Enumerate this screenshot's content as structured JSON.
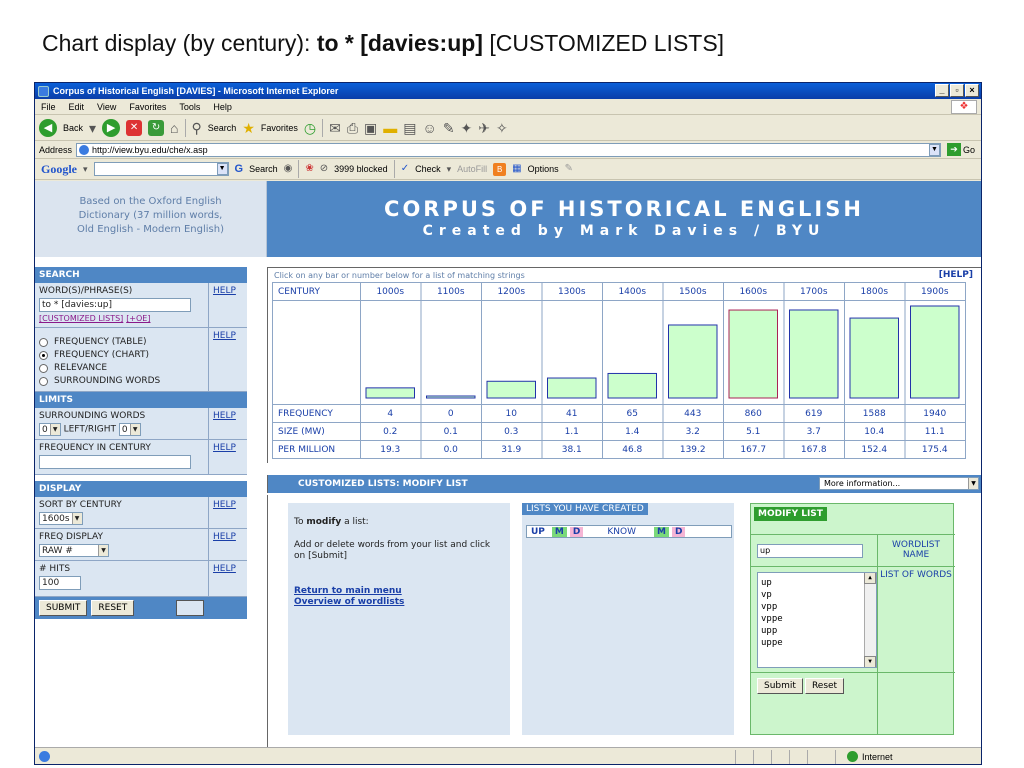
{
  "slide": {
    "prefix": "Chart display (by century): ",
    "query": "to * [davies:up]",
    "suffix": " [CUSTOMIZED LISTS]"
  },
  "browser": {
    "title": "Corpus of Historical English [DAVIES] - Microsoft Internet Explorer",
    "menu": [
      "File",
      "Edit",
      "View",
      "Favorites",
      "Tools",
      "Help"
    ],
    "toolbar": {
      "back": "Back",
      "search": "Search",
      "favorites": "Favorites"
    },
    "address_label": "Address",
    "address_url": "http://view.byu.edu/che/x.asp",
    "go_label": "Go",
    "google": {
      "logo": "Google",
      "search": "Search",
      "blocked": "3999 blocked",
      "check": "Check",
      "autofill": "AutoFill",
      "options": "Options"
    },
    "status_zone": "Internet"
  },
  "header": {
    "left_text": [
      "Based on the Oxford English",
      "Dictionary (37 million words,",
      "Old English - Modern English)"
    ],
    "site_title": "CORPUS OF HISTORICAL ENGLISH",
    "site_subtitle": "Created by Mark Davies / BYU"
  },
  "sidebar": {
    "search_head": "SEARCH",
    "word_label": "WORD(S)/PHRASE(S)",
    "help": "HELP",
    "word_value": "to * [davies:up]",
    "customized_link": "[CUSTOMIZED LISTS]",
    "oe_link": "[+OE]",
    "radios": [
      {
        "label": "FREQUENCY (TABLE)",
        "checked": false
      },
      {
        "label": "FREQUENCY (CHART)",
        "checked": true
      },
      {
        "label": "RELEVANCE",
        "checked": false
      },
      {
        "label": "SURROUNDING WORDS",
        "checked": false
      }
    ],
    "limits_head": "LIMITS",
    "surrounding_label": "SURROUNDING WORDS",
    "left_value": "0",
    "leftright_label": "LEFT/RIGHT",
    "right_value": "0",
    "freq_century_label": "FREQUENCY IN CENTURY",
    "display_head": "DISPLAY",
    "sort_label": "SORT BY CENTURY",
    "sort_value": "1600s",
    "freq_display_label": "FREQ DISPLAY",
    "freq_display_value": "RAW #",
    "hits_label": "# HITS",
    "hits_value": "100",
    "submit": "SUBMIT",
    "reset": "RESET"
  },
  "chart_caption": "Click on any bar or number below for a list of matching strings",
  "chart_help": "[HELP]",
  "chart_data": {
    "type": "bar",
    "header_label": "CENTURY",
    "categories": [
      "1000s",
      "1100s",
      "1200s",
      "1300s",
      "1400s",
      "1500s",
      "1600s",
      "1700s",
      "1800s",
      "1900s"
    ],
    "bar_values": [
      19.3,
      0.0,
      31.9,
      38.1,
      46.8,
      139.2,
      167.7,
      167.8,
      152.4,
      175.4
    ],
    "highlight_index": 6,
    "rows": [
      {
        "label": "FREQUENCY",
        "values": [
          "4",
          "0",
          "10",
          "41",
          "65",
          "443",
          "860",
          "619",
          "1588",
          "1940"
        ]
      },
      {
        "label": "SIZE (MW)",
        "values": [
          "0.2",
          "0.1",
          "0.3",
          "1.1",
          "1.4",
          "3.2",
          "5.1",
          "3.7",
          "10.4",
          "11.1"
        ]
      },
      {
        "label": "PER MILLION",
        "values": [
          "19.3",
          "0.0",
          "31.9",
          "38.1",
          "46.8",
          "139.2",
          "167.7",
          "167.8",
          "152.4",
          "175.4"
        ]
      }
    ],
    "colors": {
      "bar_fill": "#ccffcc",
      "bar_stroke": "#2233aa",
      "highlight_stroke": "#aa2255"
    }
  },
  "custom_lists": {
    "bar_title": "CUSTOMIZED LISTS: MODIFY LIST",
    "more_info": "More information...",
    "info_intro_pre": "To ",
    "info_intro_bold": "modify",
    "info_intro_post": " a list:",
    "info_body": "Add or delete words from your list and click on [Submit]",
    "return_link": "Return to main menu",
    "overview_link": "Overview of wordlists",
    "created_head": "LISTS YOU HAVE CREATED",
    "list1_name": "UP",
    "list2_name": "KNOW",
    "m_label": "M",
    "d_label": "D",
    "modify_head": "MODIFY LIST",
    "name_value": "up",
    "wordlist_name_label": "WORDLIST NAME",
    "list_words_label": "LIST OF WORDS",
    "words": [
      "up",
      "vp",
      "vpp",
      "vppe",
      "upp",
      "uppe"
    ],
    "submit": "Submit",
    "reset": "Reset"
  }
}
